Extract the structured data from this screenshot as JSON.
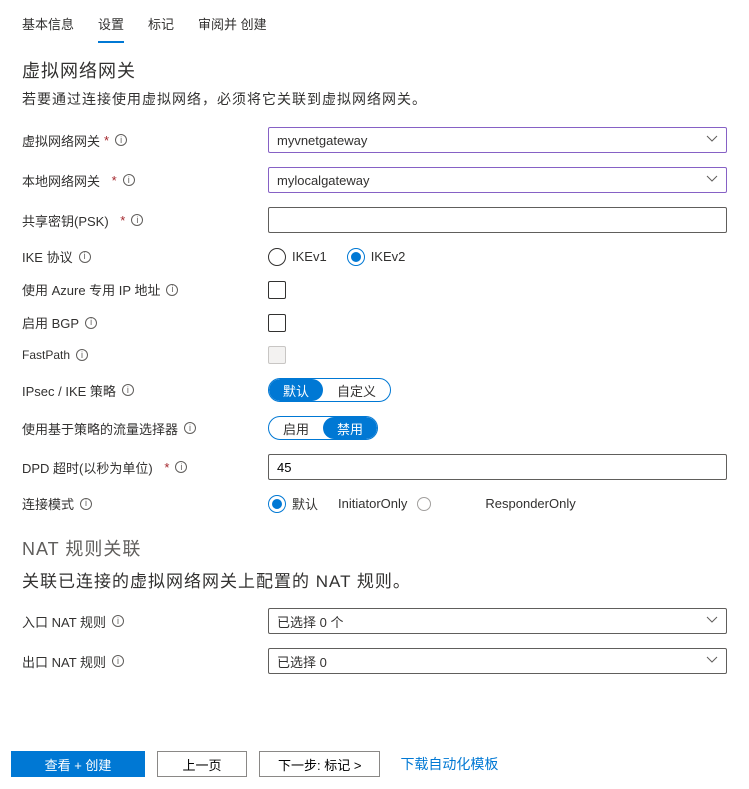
{
  "tabs": [
    "基本信息",
    "设置",
    "标记",
    "审阅并 创建"
  ],
  "active_tab_index": 1,
  "section": {
    "title": "虚拟网络网关",
    "desc": "若要通过连接使用虚拟网络，必须将它关联到虚拟网络网关。"
  },
  "fields": {
    "vnet_gw": {
      "label": "虚拟网络网关",
      "value": "myvnetgateway"
    },
    "local_gw": {
      "label": "本地网络网关",
      "value": "mylocalgateway"
    },
    "psk": {
      "label": "共享密钥(PSK)",
      "value": ""
    },
    "ike": {
      "label": "IKE 协议",
      "options": [
        "IKEv1",
        "IKEv2"
      ],
      "selected": "IKEv2"
    },
    "private_ip": {
      "label": "使用 Azure 专用 IP 地址"
    },
    "bgp": {
      "label": "启用 BGP"
    },
    "fastpath": {
      "label": "FastPath"
    },
    "ipsec": {
      "label": "IPsec / IKE 策略",
      "options": [
        "默认",
        "自定义"
      ],
      "active": 0
    },
    "traffic": {
      "label": "使用基于策略的流量选择器",
      "options": [
        "启用",
        "禁用"
      ],
      "active": 1
    },
    "dpd": {
      "label": "DPD 超时(以秒为单位)",
      "value": "45"
    },
    "conn_mode": {
      "label": "连接模式",
      "options": {
        "a": "默认",
        "b": "InitiatorOnly",
        "c": "ResponderOnly"
      }
    }
  },
  "nat": {
    "title": "NAT 规则关联",
    "desc": "关联已连接的虚拟网络网关上配置的 NAT 规则。",
    "in": {
      "label": "入口 NAT 规则",
      "value": "已选择 0 个"
    },
    "out": {
      "label": "出口 NAT 规则",
      "value": "已选择 0"
    }
  },
  "footer": {
    "review": "查看 + 创建",
    "prev": "上一页",
    "next": "下一步: 标记 >",
    "download": "下载自动化模板"
  },
  "glyph": {
    "asterisk": "*"
  }
}
